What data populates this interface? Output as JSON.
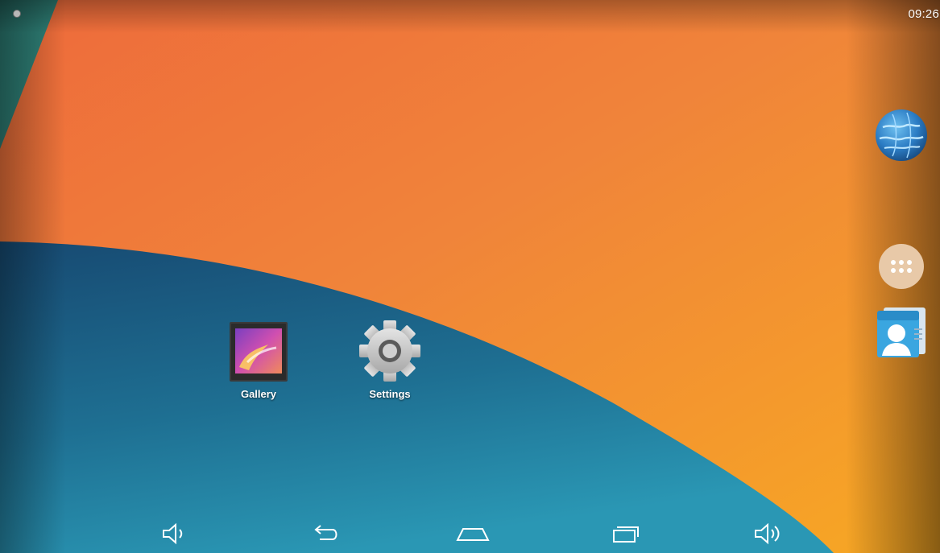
{
  "status_bar": {
    "time": "09:26"
  },
  "home_screen": {
    "apps": [
      {
        "label": "Gallery",
        "icon": "gallery-icon"
      },
      {
        "label": "Settings",
        "icon": "settings-gear-icon"
      }
    ]
  },
  "dock": {
    "items": [
      {
        "icon": "browser-globe-icon"
      },
      {
        "icon": "all-apps-icon"
      },
      {
        "icon": "contacts-icon"
      }
    ]
  },
  "nav_bar": {
    "buttons": [
      {
        "icon": "volume-down-icon"
      },
      {
        "icon": "back-icon"
      },
      {
        "icon": "home-icon"
      },
      {
        "icon": "recent-apps-icon"
      },
      {
        "icon": "volume-up-icon"
      }
    ]
  },
  "colors": {
    "wallpaper_orange": "#f0843a",
    "wallpaper_red_orange": "#ef6a3a",
    "wallpaper_yellow": "#f6a723",
    "wallpaper_blue": "#1e6f92",
    "wallpaper_dark_blue": "#174a72",
    "wallpaper_teal": "#2c7f7a",
    "all_apps_bg": "#e8c9a8"
  }
}
